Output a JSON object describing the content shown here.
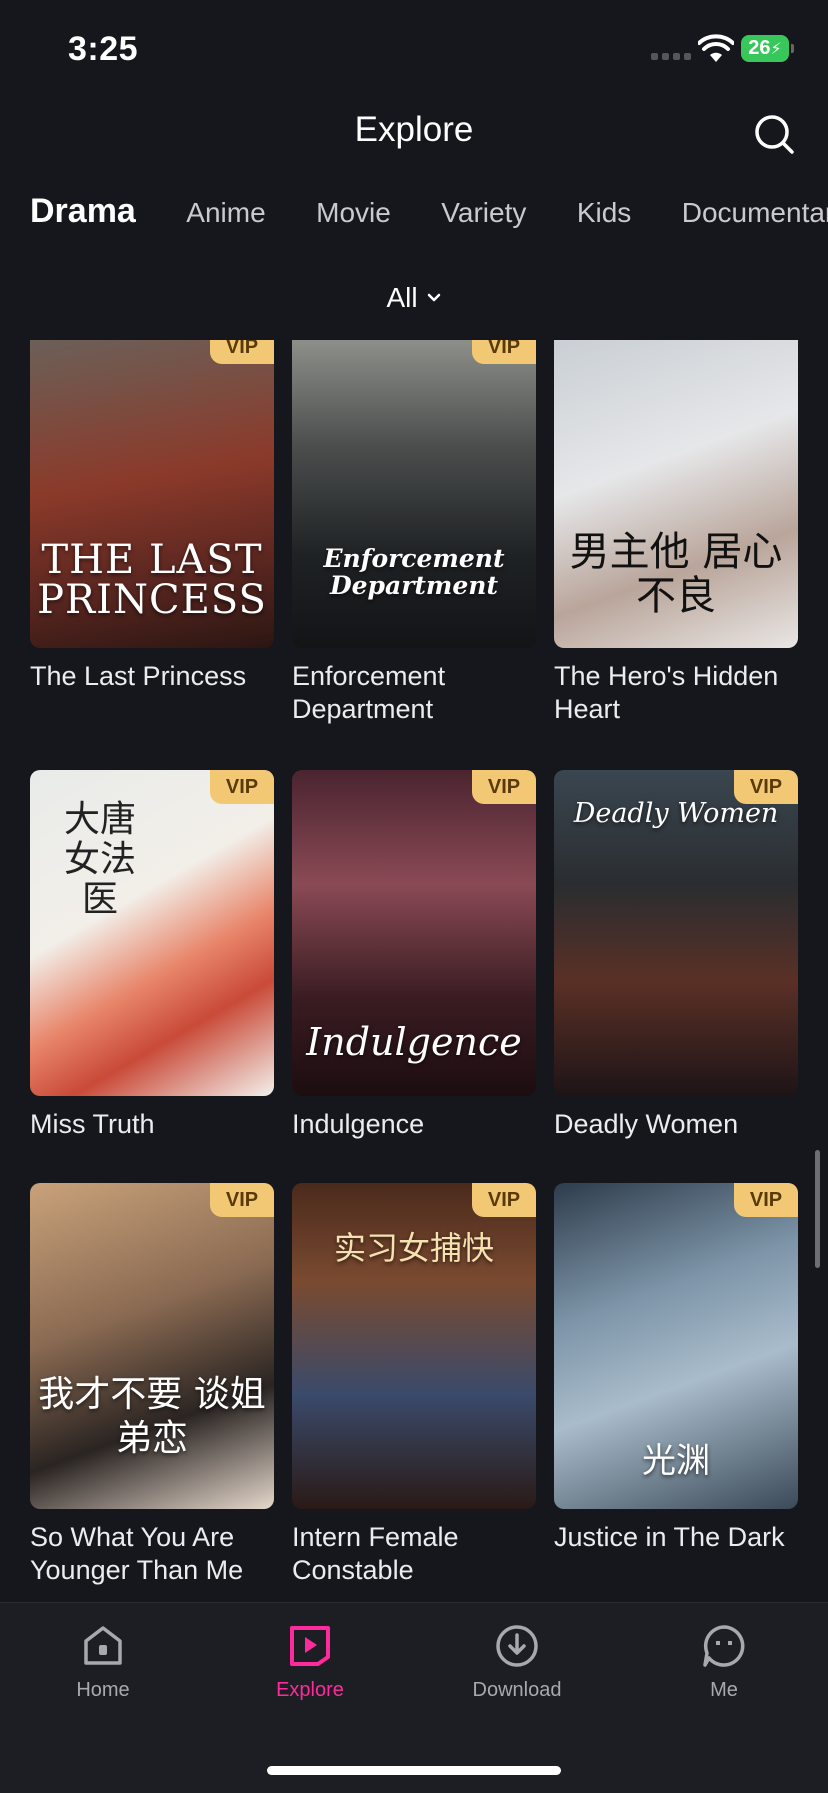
{
  "status_bar": {
    "time": "3:25",
    "battery": "26"
  },
  "header": {
    "title": "Explore",
    "search_icon": "search-icon"
  },
  "tabs": [
    {
      "label": "Drama",
      "active": true
    },
    {
      "label": "Anime"
    },
    {
      "label": "Movie"
    },
    {
      "label": "Variety"
    },
    {
      "label": "Kids"
    },
    {
      "label": "Documentary"
    }
  ],
  "filter": {
    "label": "All"
  },
  "badge": "VIP",
  "items": [
    {
      "title": "The Last Princess",
      "poster_text": "THE LAST PRINCESS",
      "vip": true
    },
    {
      "title": "Enforcement Department",
      "poster_text": "Enforcement Department",
      "vip": true
    },
    {
      "title": "The Hero's Hidden Heart",
      "poster_text": "男主他 居心不良",
      "vip": false
    },
    {
      "title": "Miss Truth",
      "poster_text": "大唐 女法医",
      "vip": true
    },
    {
      "title": "Indulgence",
      "poster_text": "Indulgence",
      "vip": true
    },
    {
      "title": "Deadly Women",
      "poster_text": "Deadly Women",
      "vip": true
    },
    {
      "title": "So What You Are Younger Than Me",
      "poster_text": "我才不要 谈姐弟恋",
      "vip": true
    },
    {
      "title": "Intern Female Constable",
      "poster_text": "实习女捕快",
      "vip": true
    },
    {
      "title": "Justice in The Dark",
      "poster_text": "光渊",
      "vip": true
    }
  ],
  "bottom_nav": [
    {
      "label": "Home"
    },
    {
      "label": "Explore",
      "active": true
    },
    {
      "label": "Download"
    },
    {
      "label": "Me"
    }
  ],
  "colors": {
    "accent": "#ff2a9c",
    "vip_badge": "#f2c874",
    "background": "#16161d"
  }
}
